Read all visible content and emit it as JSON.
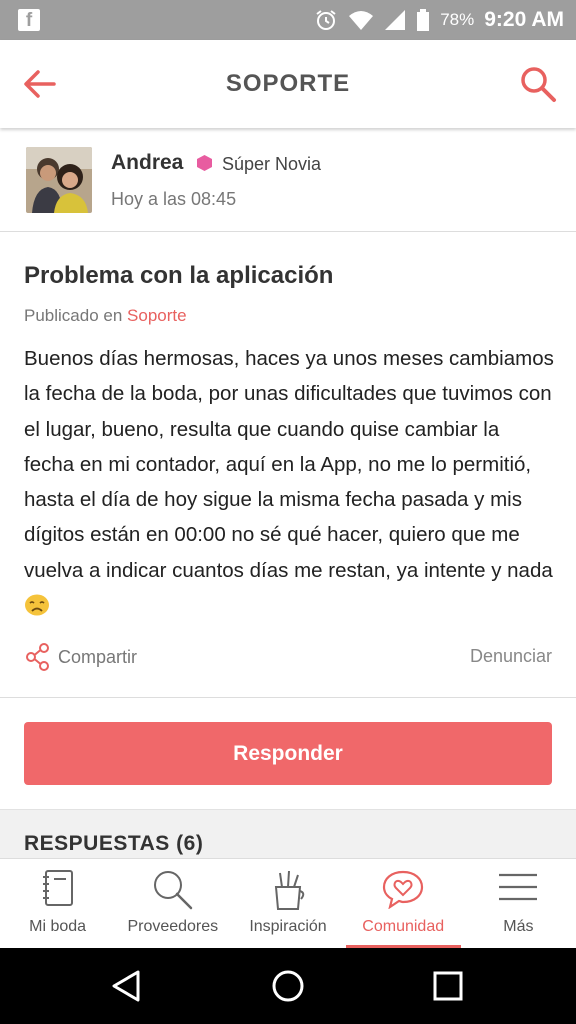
{
  "status_bar": {
    "battery": "78%",
    "time": "9:20 AM"
  },
  "app_bar": {
    "title": "SOPORTE"
  },
  "author": {
    "name": "Andrea",
    "badge": "Súper Novia",
    "time": "Hoy a las 08:45"
  },
  "post": {
    "title": "Problema con la aplicación",
    "published_prefix": "Publicado en",
    "published_link": "Soporte",
    "body": "Buenos días hermosas, haces ya unos meses cambiamos la fecha de la boda, por unas dificultades que tuvimos con el lugar, bueno, resulta que cuando quise cambiar la fecha en mi contador, aquí en la App, no me lo permitió, hasta el día de hoy sigue la misma fecha pasada y mis dígitos están en 00:00 no sé qué hacer, quiero que me vuelva a indicar cuantos días me restan, ya intente y nada",
    "share_label": "Compartir",
    "report_label": "Denunciar"
  },
  "reply_button": "Responder",
  "answers_title": "RESPUESTAS (6)",
  "bottom_nav": [
    {
      "label": "Mi boda",
      "icon": "notebook-icon"
    },
    {
      "label": "Proveedores",
      "icon": "magnifier-icon"
    },
    {
      "label": "Inspiración",
      "icon": "pencil-cup-icon"
    },
    {
      "label": "Comunidad",
      "icon": "heart-bubble-icon",
      "active": true
    },
    {
      "label": "Más",
      "icon": "menu-icon"
    }
  ],
  "colors": {
    "accent": "#e8615f",
    "button": "#f0686a",
    "badge": "#e85ca0"
  }
}
